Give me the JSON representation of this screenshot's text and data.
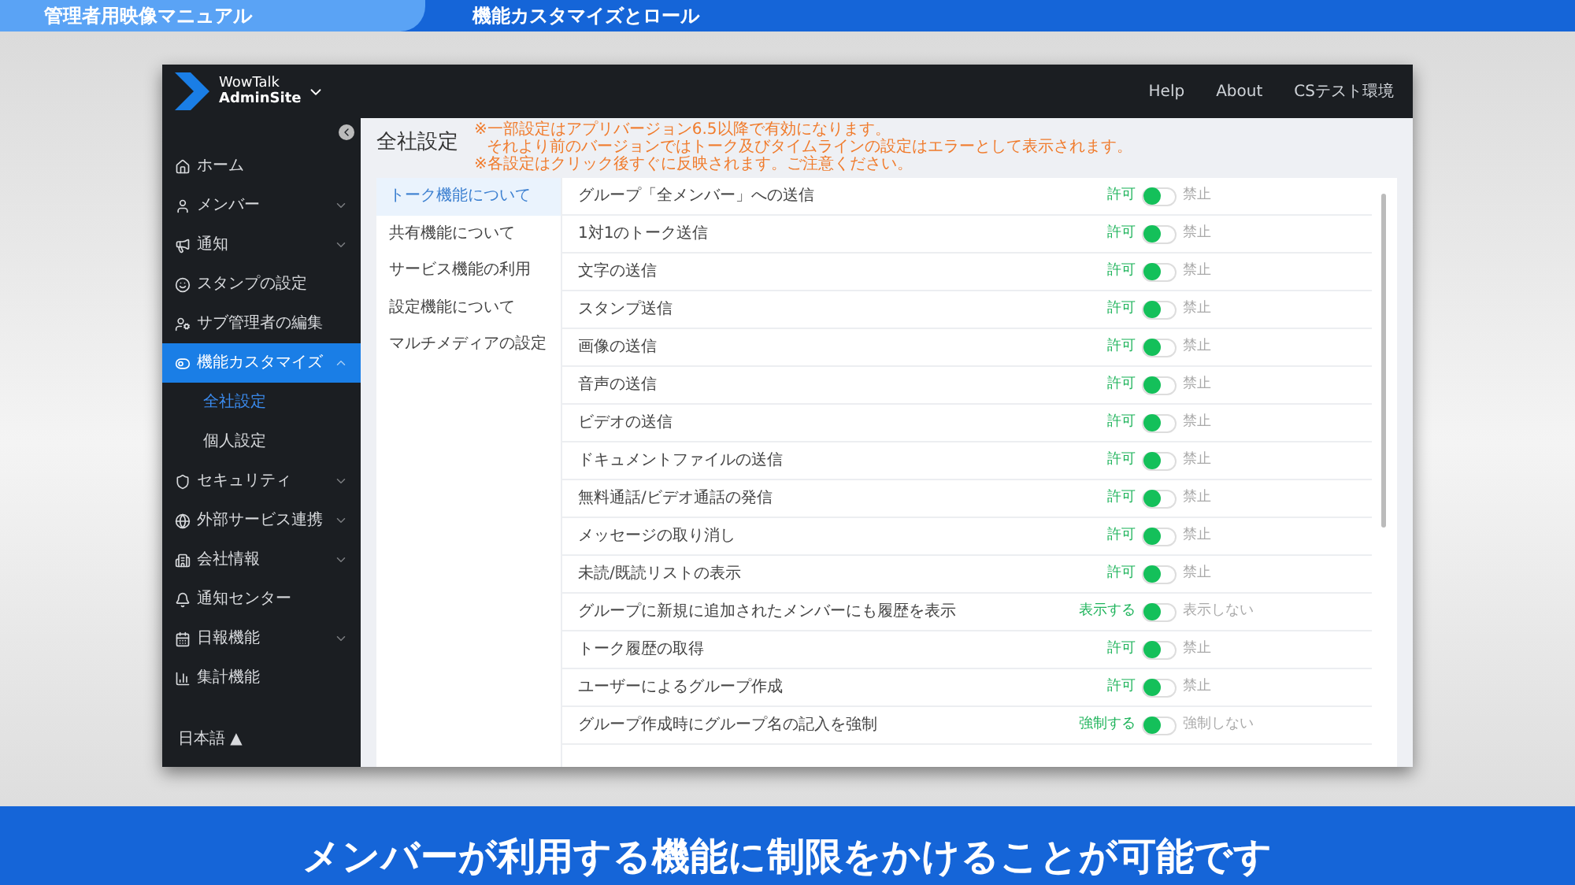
{
  "video_header": {
    "badge": "管理者用映像マニュアル",
    "title": "機能カスタマイズとロール"
  },
  "window": {
    "logo": {
      "line1": "WowTalk",
      "line2": "AdminSite"
    },
    "top_links": [
      "Help",
      "About",
      "CSテスト環境"
    ],
    "sidebar": {
      "items": [
        {
          "label": "ホーム",
          "kind": "link",
          "selected": false
        },
        {
          "label": "メンバー",
          "kind": "group",
          "expanded": false,
          "selected": false
        },
        {
          "label": "通知",
          "kind": "group",
          "expanded": false,
          "selected": false
        },
        {
          "label": "スタンプの設定",
          "kind": "link",
          "selected": false
        },
        {
          "label": "サブ管理者の編集",
          "kind": "link",
          "selected": false
        },
        {
          "label": "機能カスタマイズ",
          "kind": "group",
          "expanded": true,
          "selected": true,
          "children": [
            {
              "label": "全社設定",
              "selected": true
            },
            {
              "label": "個人設定",
              "selected": false
            }
          ]
        },
        {
          "label": "セキュリティ",
          "kind": "group",
          "expanded": false,
          "selected": false
        },
        {
          "label": "外部サービス連携",
          "kind": "group",
          "expanded": false,
          "selected": false
        },
        {
          "label": "会社情報",
          "kind": "group",
          "expanded": false,
          "selected": false
        },
        {
          "label": "通知センター",
          "kind": "link",
          "selected": false
        },
        {
          "label": "日報機能",
          "kind": "group",
          "expanded": false,
          "selected": false
        },
        {
          "label": "集計機能",
          "kind": "link",
          "selected": false
        }
      ],
      "language": "日本語 ▲"
    },
    "page_title": "全社設定",
    "notes": [
      "※一部設定はアプリバージョン6.5以降で有効になります。",
      "それより前のバージョンではトーク及びタイムラインの設定はエラーとして表示されます。",
      "※各設定はクリック後すぐに反映されます。ご注意ください。"
    ],
    "sections": [
      {
        "label": "トーク機能について",
        "selected": true
      },
      {
        "label": "共有機能について",
        "selected": false
      },
      {
        "label": "サービス機能の利用",
        "selected": false
      },
      {
        "label": "設定機能について",
        "selected": false
      },
      {
        "label": "マルチメディアの設定",
        "selected": false
      }
    ],
    "settings": [
      {
        "label": "グループ「全メンバー」への送信",
        "allow_label": "許可",
        "deny_label": "禁止",
        "allowed": true
      },
      {
        "label": "1対1のトーク送信",
        "allow_label": "許可",
        "deny_label": "禁止",
        "allowed": true
      },
      {
        "label": "文字の送信",
        "allow_label": "許可",
        "deny_label": "禁止",
        "allowed": true
      },
      {
        "label": "スタンプ送信",
        "allow_label": "許可",
        "deny_label": "禁止",
        "allowed": true
      },
      {
        "label": "画像の送信",
        "allow_label": "許可",
        "deny_label": "禁止",
        "allowed": true
      },
      {
        "label": "音声の送信",
        "allow_label": "許可",
        "deny_label": "禁止",
        "allowed": true
      },
      {
        "label": "ビデオの送信",
        "allow_label": "許可",
        "deny_label": "禁止",
        "allowed": true
      },
      {
        "label": "ドキュメントファイルの送信",
        "allow_label": "許可",
        "deny_label": "禁止",
        "allowed": true
      },
      {
        "label": "無料通話/ビデオ通話の発信",
        "allow_label": "許可",
        "deny_label": "禁止",
        "allowed": true
      },
      {
        "label": "メッセージの取り消し",
        "allow_label": "許可",
        "deny_label": "禁止",
        "allowed": true
      },
      {
        "label": "未読/既読リストの表示",
        "allow_label": "許可",
        "deny_label": "禁止",
        "allowed": true
      },
      {
        "label": "グループに新規に追加されたメンバーにも履歴を表示",
        "allow_label": "表示する",
        "deny_label": "表示しない",
        "allowed": true
      },
      {
        "label": "トーク履歴の取得",
        "allow_label": "許可",
        "deny_label": "禁止",
        "allowed": true
      },
      {
        "label": "ユーザーによるグループ作成",
        "allow_label": "許可",
        "deny_label": "禁止",
        "allowed": true
      },
      {
        "label": "グループ作成時にグループ名の記入を強制",
        "allow_label": "強制する",
        "deny_label": "強制しない",
        "allowed": true
      }
    ]
  },
  "caption": "メンバーが利用する機能に制限をかけることが可能です"
}
